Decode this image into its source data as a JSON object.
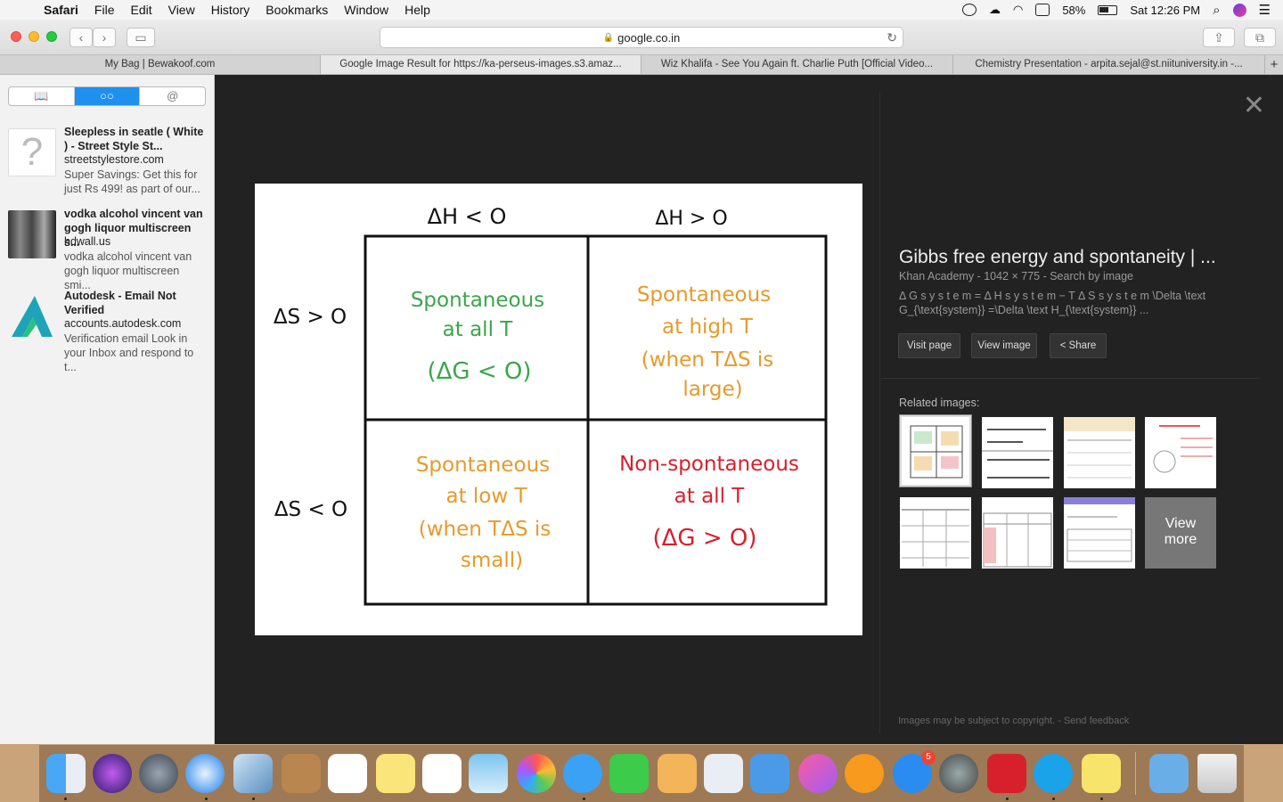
{
  "menubar": {
    "app": "Safari",
    "items": [
      "File",
      "Edit",
      "View",
      "History",
      "Bookmarks",
      "Window",
      "Help"
    ],
    "battery": "58%",
    "clock": "Sat 12:26 PM"
  },
  "toolbar": {
    "url": "google.co.in"
  },
  "tabs": [
    {
      "label": "My Bag | Bewakoof.com"
    },
    {
      "label": "Google Image Result for https://ka-perseus-images.s3.amaz..."
    },
    {
      "label": "Wiz Khalifa - See You Again ft. Charlie Puth [Official Video..."
    },
    {
      "label": "Chemistry Presentation - arpita.sejal@st.niituniversity.in -..."
    }
  ],
  "sidebar": {
    "items": [
      {
        "title": "Sleepless in seatle ( White ) - Street Style St...",
        "host": "streetstylestore.com",
        "desc": "Super Savings: Get this for just Rs 499! as part of our..."
      },
      {
        "title": "vodka alcohol vincent van gogh liquor multiscreen s...",
        "host": "hdwall.us",
        "desc": "vodka alcohol vincent van gogh liquor multiscreen smi..."
      },
      {
        "title": "Autodesk - Email Not Verified",
        "host": "accounts.autodesk.com",
        "desc": "Verification email Look in your Inbox and respond to t..."
      }
    ]
  },
  "diagram": {
    "col1": "ΔH < O",
    "col2": "ΔH > O",
    "row1": "ΔS > O",
    "row2": "ΔS < O",
    "c11": [
      "Spontaneous",
      "at  all  T",
      "(ΔG < O)"
    ],
    "c12": [
      "Spontaneous",
      "at  high T",
      "(when  TΔS  is",
      "large)"
    ],
    "c21": [
      "Spontaneous",
      "at  low  T",
      "(when  TΔS  is",
      "small)"
    ],
    "c22": [
      "Non-spontaneous",
      "at  all  T",
      "(ΔG > O)"
    ],
    "colors": {
      "green": "#3aa64a",
      "orange": "#e79a2a",
      "red": "#d8202d"
    }
  },
  "panel": {
    "title": "Gibbs free energy and spontaneity | ...",
    "meta": "Khan Academy  -  1042 × 775  -  Search by image",
    "desc": "Δ G s y s t e m = Δ H s y s t e m − T Δ S s y s t e m \\Delta \\text G_{\\text{system}} =\\Delta \\text H_{\\text{system}} ...",
    "visit": "Visit page",
    "view": "View image",
    "share": "Share",
    "related": "Related images:",
    "view_more_1": "View",
    "view_more_2": "more",
    "footer": "Images may be subject to copyright.  -  Send feedback"
  }
}
